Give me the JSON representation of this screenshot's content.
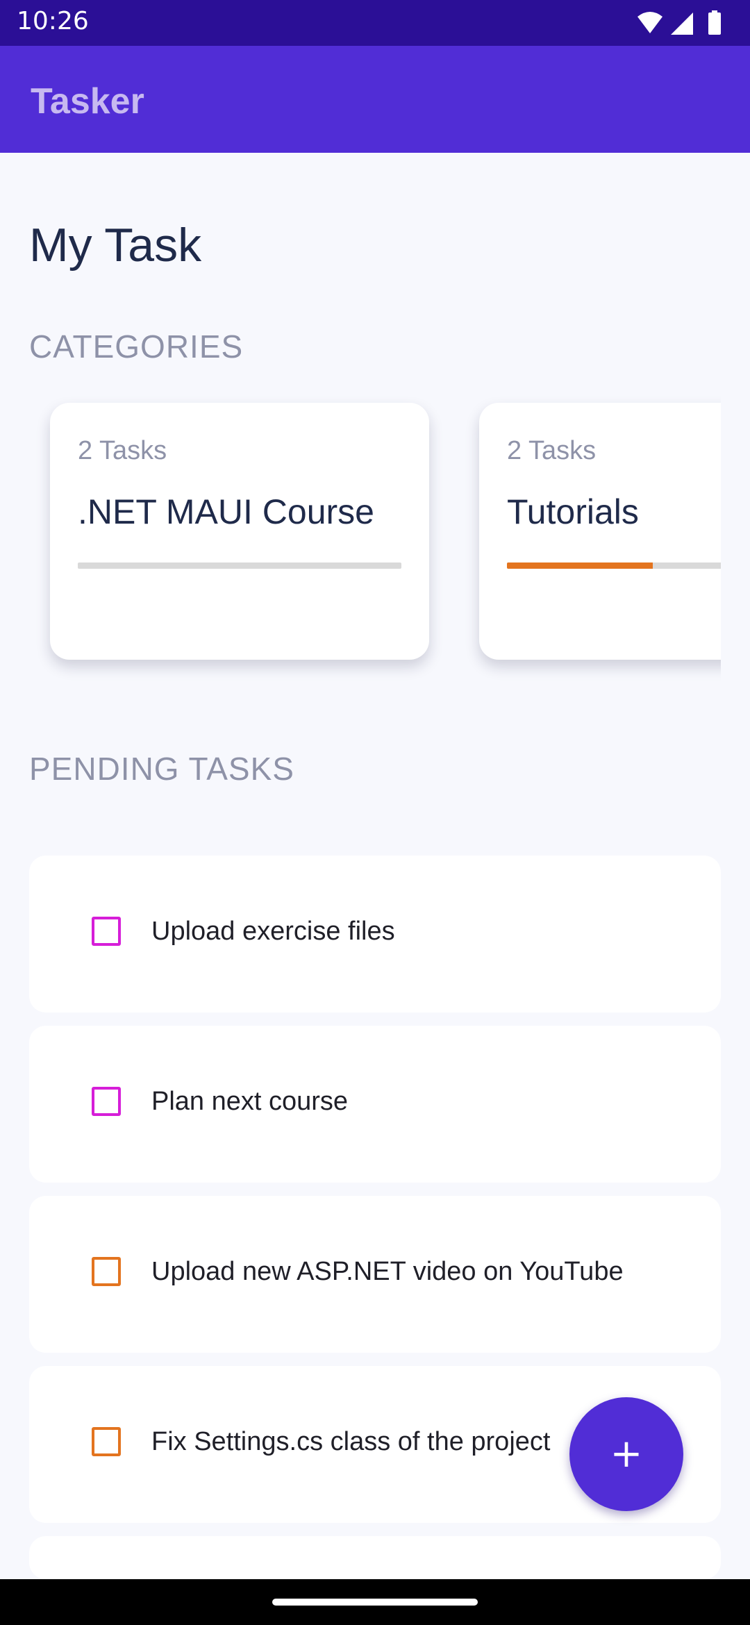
{
  "status_bar": {
    "time": "10:26",
    "icons": [
      "wifi-icon",
      "signal-icon",
      "battery-icon"
    ]
  },
  "app_bar": {
    "title": "Tasker"
  },
  "main": {
    "title": "My Task",
    "categories_label": "CATEGORIES",
    "pending_label": "PENDING TASKS"
  },
  "categories": [
    {
      "count": "2 Tasks",
      "name": ".NET MAUI Course",
      "progress": 0,
      "color": "#D61ED8"
    },
    {
      "count": "2 Tasks",
      "name": "Tutorials",
      "progress": 0.45,
      "color": "#E3741F"
    }
  ],
  "tasks": [
    {
      "label": "Upload exercise files",
      "color": "#D61ED8"
    },
    {
      "label": "Plan next course",
      "color": "#D61ED8"
    },
    {
      "label": "Upload new ASP.NET video on YouTube",
      "color": "#E3741F"
    },
    {
      "label": "Fix Settings.cs class of the project",
      "color": "#E3741F"
    }
  ],
  "fab": {
    "icon": "plus-icon",
    "label": "+"
  },
  "colors": {
    "status_bar": "#2B0F96",
    "app_bar": "#512DD6",
    "accent": "#512DD6",
    "background": "#F7F8FD"
  }
}
